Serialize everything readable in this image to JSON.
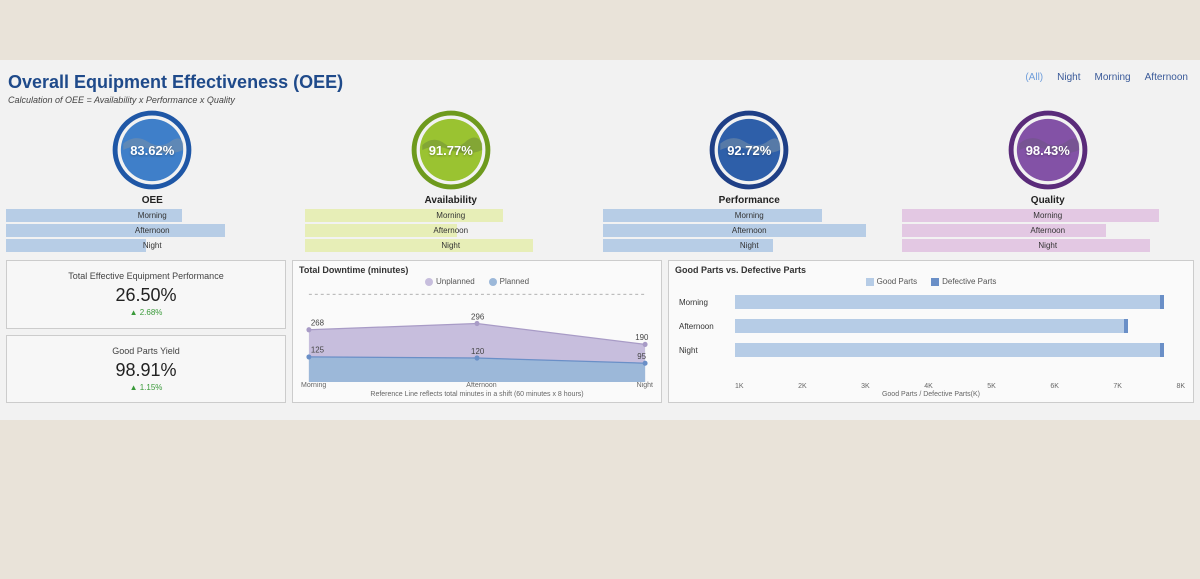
{
  "header": {
    "title": "Overall Equipment Effectiveness (OEE)",
    "subtitle": "Calculation of OEE = Availability x Performance x Quality"
  },
  "filters": {
    "items": [
      "(All)",
      "Night",
      "Morning",
      "Afternoon"
    ],
    "active": 0
  },
  "metrics": [
    {
      "name": "OEE",
      "value": "83.62%",
      "color_ring": "#1f57a6",
      "color_fill": "#3f7fc9",
      "bar_color": "#b7cde6",
      "shifts": [
        {
          "label": "Morning",
          "pct": 60
        },
        {
          "label": "Afternoon",
          "pct": 75
        },
        {
          "label": "Night",
          "pct": 48
        }
      ]
    },
    {
      "name": "Availability",
      "value": "91.77%",
      "color_ring": "#6e9a1d",
      "color_fill": "#9ac331",
      "bar_color": "#e7eeb7",
      "shifts": [
        {
          "label": "Morning",
          "pct": 68
        },
        {
          "label": "Afternoon",
          "pct": 52
        },
        {
          "label": "Night",
          "pct": 78
        }
      ]
    },
    {
      "name": "Performance",
      "value": "92.72%",
      "color_ring": "#1f3f86",
      "color_fill": "#2e5fa9",
      "bar_color": "#b7cde6",
      "shifts": [
        {
          "label": "Morning",
          "pct": 75
        },
        {
          "label": "Afternoon",
          "pct": 90
        },
        {
          "label": "Night",
          "pct": 58
        }
      ]
    },
    {
      "name": "Quality",
      "value": "98.43%",
      "color_ring": "#5a2b7a",
      "color_fill": "#8352a6",
      "bar_color": "#e3c8e3",
      "shifts": [
        {
          "label": "Morning",
          "pct": 88
        },
        {
          "label": "Afternoon",
          "pct": 70
        },
        {
          "label": "Night",
          "pct": 85
        }
      ]
    }
  ],
  "kpis": [
    {
      "label": "Total Effective Equipment Performance",
      "value": "26.50%",
      "delta": "2.68%"
    },
    {
      "label": "Good Parts Yield",
      "value": "98.91%",
      "delta": "1.15%"
    }
  ],
  "downtime": {
    "title": "Total Downtime (minutes)",
    "legend": [
      {
        "name": "Unplanned",
        "color": "#c7bedd"
      },
      {
        "name": "Planned",
        "color": "#9cb8d9"
      }
    ],
    "footnote": "Reference Line reflects total minutes in a shift (60 minutes x 8 hours)",
    "categories": [
      "Morning",
      "Afternoon",
      "Night"
    ],
    "unplanned_labels": [
      "268",
      "296",
      "190"
    ],
    "planned_labels": [
      "125",
      "120",
      "95"
    ]
  },
  "goodparts": {
    "title": "Good Parts vs. Defective Parts",
    "legend": [
      {
        "name": "Good Parts",
        "color": "#b6cce6"
      },
      {
        "name": "Defective Parts",
        "color": "#6a8fc7"
      }
    ],
    "rows": [
      {
        "label": "Morning",
        "good_pct": 94,
        "bad_left_pct": 94,
        "bad_w_pct": 1
      },
      {
        "label": "Afternoon",
        "good_pct": 86,
        "bad_left_pct": 86,
        "bad_w_pct": 1
      },
      {
        "label": "Night",
        "good_pct": 94,
        "bad_left_pct": 94,
        "bad_w_pct": 1
      }
    ],
    "axis_ticks": [
      "1K",
      "2K",
      "3K",
      "4K",
      "5K",
      "6K",
      "7K",
      "8K"
    ],
    "axis_label": "Good Parts / Defective Parts(K)"
  },
  "chart_data": [
    {
      "type": "bar",
      "title": "OEE by shift",
      "categories": [
        "Morning",
        "Afternoon",
        "Night"
      ],
      "values_pct_of_max": [
        60,
        75,
        48
      ]
    },
    {
      "type": "bar",
      "title": "Availability by shift",
      "categories": [
        "Morning",
        "Afternoon",
        "Night"
      ],
      "values_pct_of_max": [
        68,
        52,
        78
      ]
    },
    {
      "type": "bar",
      "title": "Performance by shift",
      "categories": [
        "Morning",
        "Afternoon",
        "Night"
      ],
      "values_pct_of_max": [
        75,
        90,
        58
      ]
    },
    {
      "type": "bar",
      "title": "Quality by shift",
      "categories": [
        "Morning",
        "Afternoon",
        "Night"
      ],
      "values_pct_of_max": [
        88,
        70,
        85
      ]
    },
    {
      "type": "area",
      "title": "Total Downtime (minutes)",
      "categories": [
        "Morning",
        "Afternoon",
        "Night"
      ],
      "series": [
        {
          "name": "Unplanned",
          "values": [
            268,
            296,
            190
          ]
        },
        {
          "name": "Planned",
          "values": [
            125,
            120,
            95
          ]
        }
      ],
      "ylabel": "minutes",
      "reference_line": 480
    },
    {
      "type": "bar",
      "orientation": "horizontal",
      "title": "Good Parts vs. Defective Parts",
      "categories": [
        "Morning",
        "Afternoon",
        "Night"
      ],
      "series": [
        {
          "name": "Good Parts",
          "values": [
            7400,
            6800,
            7400
          ]
        },
        {
          "name": "Defective Parts",
          "values": [
            80,
            70,
            80
          ]
        }
      ],
      "xlabel": "Good Parts / Defective Parts (K)",
      "xlim": [
        1000,
        8000
      ]
    }
  ]
}
